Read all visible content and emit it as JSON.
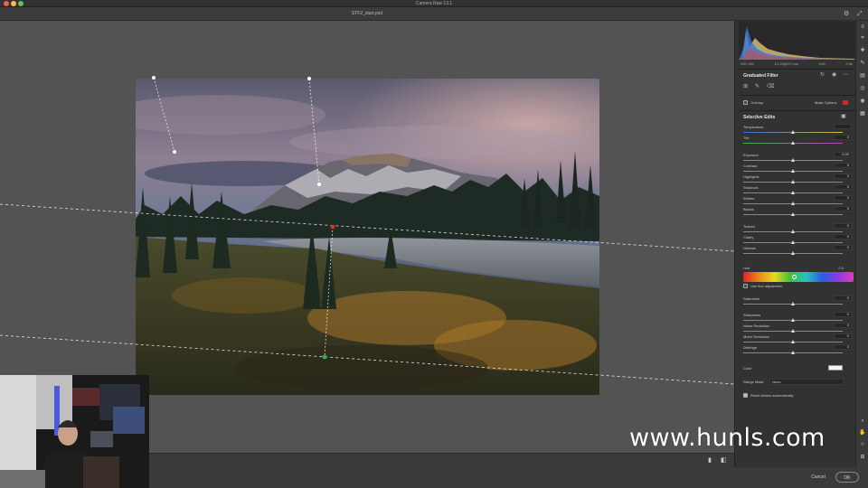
{
  "window": {
    "title": "Camera Raw 13.1",
    "document_name": "STF2_start.psd"
  },
  "header_icons": {
    "settings": "gear-icon",
    "fullscreen": "expand-icon"
  },
  "camera_info": {
    "iso": "ISO 100",
    "lens": "14-24@17 mm",
    "aperture": "f/16",
    "shutter": "2.5s"
  },
  "panel": {
    "title": "Graduated Filter",
    "overlay_label": "Overlay",
    "mask_options_label": "Mask Options",
    "mask_color": "#d22222",
    "selective_edits_title": "Selective Edits",
    "hue_label": "Hue",
    "hue_value": "0.0",
    "fine_adjustment_label": "Use fine adjustment",
    "color_label": "Color",
    "range_mask_label": "Range Mask",
    "range_mask_value": "None",
    "reset_sliders_label": "Reset sliders automatically",
    "sliders": [
      {
        "label": "Temperature",
        "value": "",
        "pos": 0.5
      },
      {
        "label": "Tint",
        "value": "0",
        "pos": 0.5
      },
      {
        "label": "Exposure",
        "value": "0.00",
        "pos": 0.5
      },
      {
        "label": "Contrast",
        "value": "0",
        "pos": 0.5
      },
      {
        "label": "Highlights",
        "value": "0",
        "pos": 0.5
      },
      {
        "label": "Shadows",
        "value": "0",
        "pos": 0.5
      },
      {
        "label": "Whites",
        "value": "0",
        "pos": 0.5
      },
      {
        "label": "Blacks",
        "value": "0",
        "pos": 0.5
      },
      {
        "label": "Texture",
        "value": "0",
        "pos": 0.5
      },
      {
        "label": "Clarity",
        "value": "0",
        "pos": 0.5
      },
      {
        "label": "Dehaze",
        "value": "0",
        "pos": 0.5
      },
      {
        "label": "Saturation",
        "value": "0",
        "pos": 0.5
      },
      {
        "label": "Sharpness",
        "value": "0",
        "pos": 0.5
      },
      {
        "label": "Noise Reduction",
        "value": "0",
        "pos": 0.5
      },
      {
        "label": "Moire Reduction",
        "value": "0",
        "pos": 0.5
      },
      {
        "label": "Defringe",
        "value": "0",
        "pos": 0.5
      }
    ]
  },
  "buttons": {
    "cancel": "Cancel",
    "ok": "OK"
  },
  "watermark": "www.hunls.com",
  "colors": {
    "canvas_bg": "#535353",
    "panel_bg": "#323232",
    "accent": "#ffffff"
  }
}
